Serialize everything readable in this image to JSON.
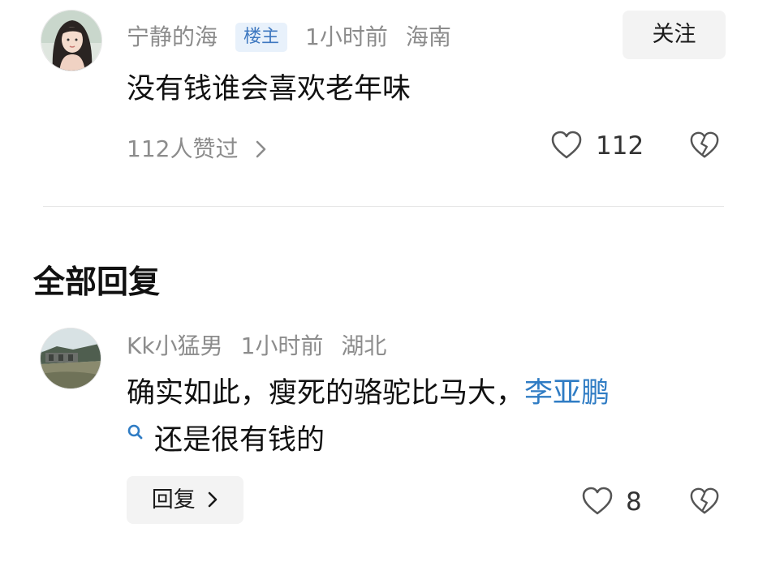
{
  "post": {
    "author": "宁静的海",
    "badge": "楼主",
    "time": "1小时前",
    "location": "海南",
    "follow_label": "关注",
    "content": "没有钱谁会喜欢老年味",
    "likes_summary": "112人赞过",
    "like_count": "112",
    "avatar_icon": "woman-portrait-avatar"
  },
  "replies_section": {
    "title": "全部回复"
  },
  "reply": {
    "author": "Kk小猛男",
    "time": "1小时前",
    "location": "湖北",
    "content_part1": "确实如此，瘦死的骆驼比马大，",
    "link_text": "李亚鹏",
    "content_part2": "还是很有钱的",
    "reply_label": "回复",
    "like_count": "8",
    "avatar_icon": "river-landscape-avatar"
  },
  "colors": {
    "link": "#2f7cc4",
    "badge_bg": "#e8f1fb",
    "badge_text": "#3e78c0",
    "meta_text": "#8c8c8c"
  }
}
